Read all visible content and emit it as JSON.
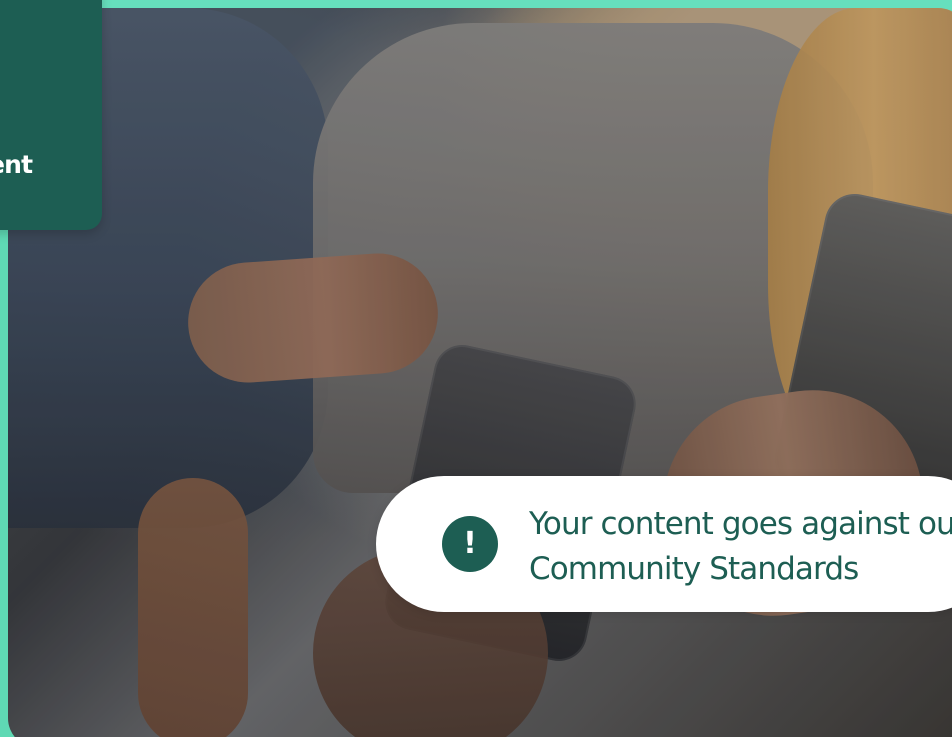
{
  "colors": {
    "accent": "#1d5e53",
    "mint": "#5fd9b4",
    "white": "#ffffff"
  },
  "menu": {
    "label_fragment": "ent"
  },
  "alert": {
    "icon": "exclamation-icon",
    "icon_text": "!",
    "line_1": "Your content goes against ou",
    "line_2": "Community Standards"
  }
}
